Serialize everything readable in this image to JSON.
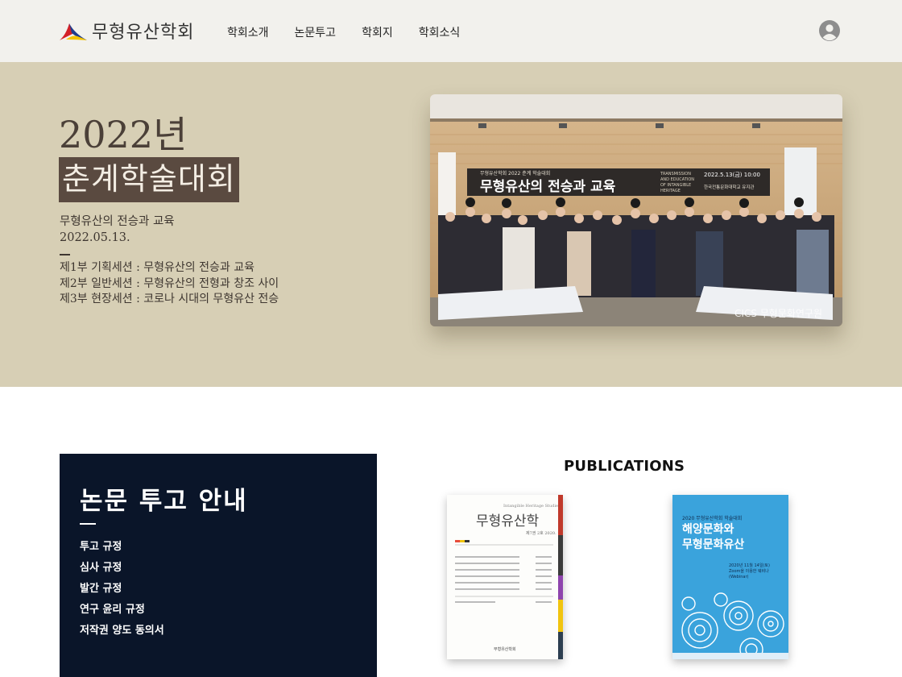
{
  "brand": {
    "name": "무형유산학회"
  },
  "nav": {
    "items": [
      "학회소개",
      "논문투고",
      "학회지",
      "학회소식"
    ]
  },
  "hero": {
    "year": "2022년",
    "title": "춘계학술대회",
    "subtitle": "무형유산의 전승과 교육",
    "date": "2022.05.13.",
    "sessions": [
      "제1부 기획세션 : 무형유산의 전승과 교육",
      "제2부 일반세션 : 무형유산의 전형과 창조 사이",
      "제3부 현장세션 : 코로나 시대의 무형유산 전승"
    ],
    "banner": {
      "org": "무형유산학회 2022 춘계 학술대회",
      "title": "무형유산의 전승과 교육",
      "en": [
        "TRANSMISSION",
        "AND EDUCATION",
        "OF INTANGIBLE",
        "HERITAGE"
      ],
      "date": "2022.5.13(금) 10:00",
      "venue": "한국전통문화대학교 유지관"
    },
    "watermark": "CICS 무형문화연구원"
  },
  "guide": {
    "title": "논문 투고 안내",
    "items": [
      "투고 규정",
      "심사 규정",
      "발간 규정",
      "연구 윤리 규정",
      "저작권 양도 동의서"
    ]
  },
  "publications": {
    "title": "PUBLICATIONS",
    "book1": {
      "en_title": "Intangible Heritage Studies",
      "title": "무형유산학",
      "volume": "제7권 2호 2020. 11",
      "publisher": "무형유산학회"
    },
    "book2": {
      "header": "2020 무형유산학회 학술대회",
      "title_lines": [
        "해양문화와",
        "무형문화유산"
      ],
      "info": [
        "2020년 11월 14일(토)",
        "Zoom을 이용한 웨비나(Webinar)"
      ]
    }
  }
}
